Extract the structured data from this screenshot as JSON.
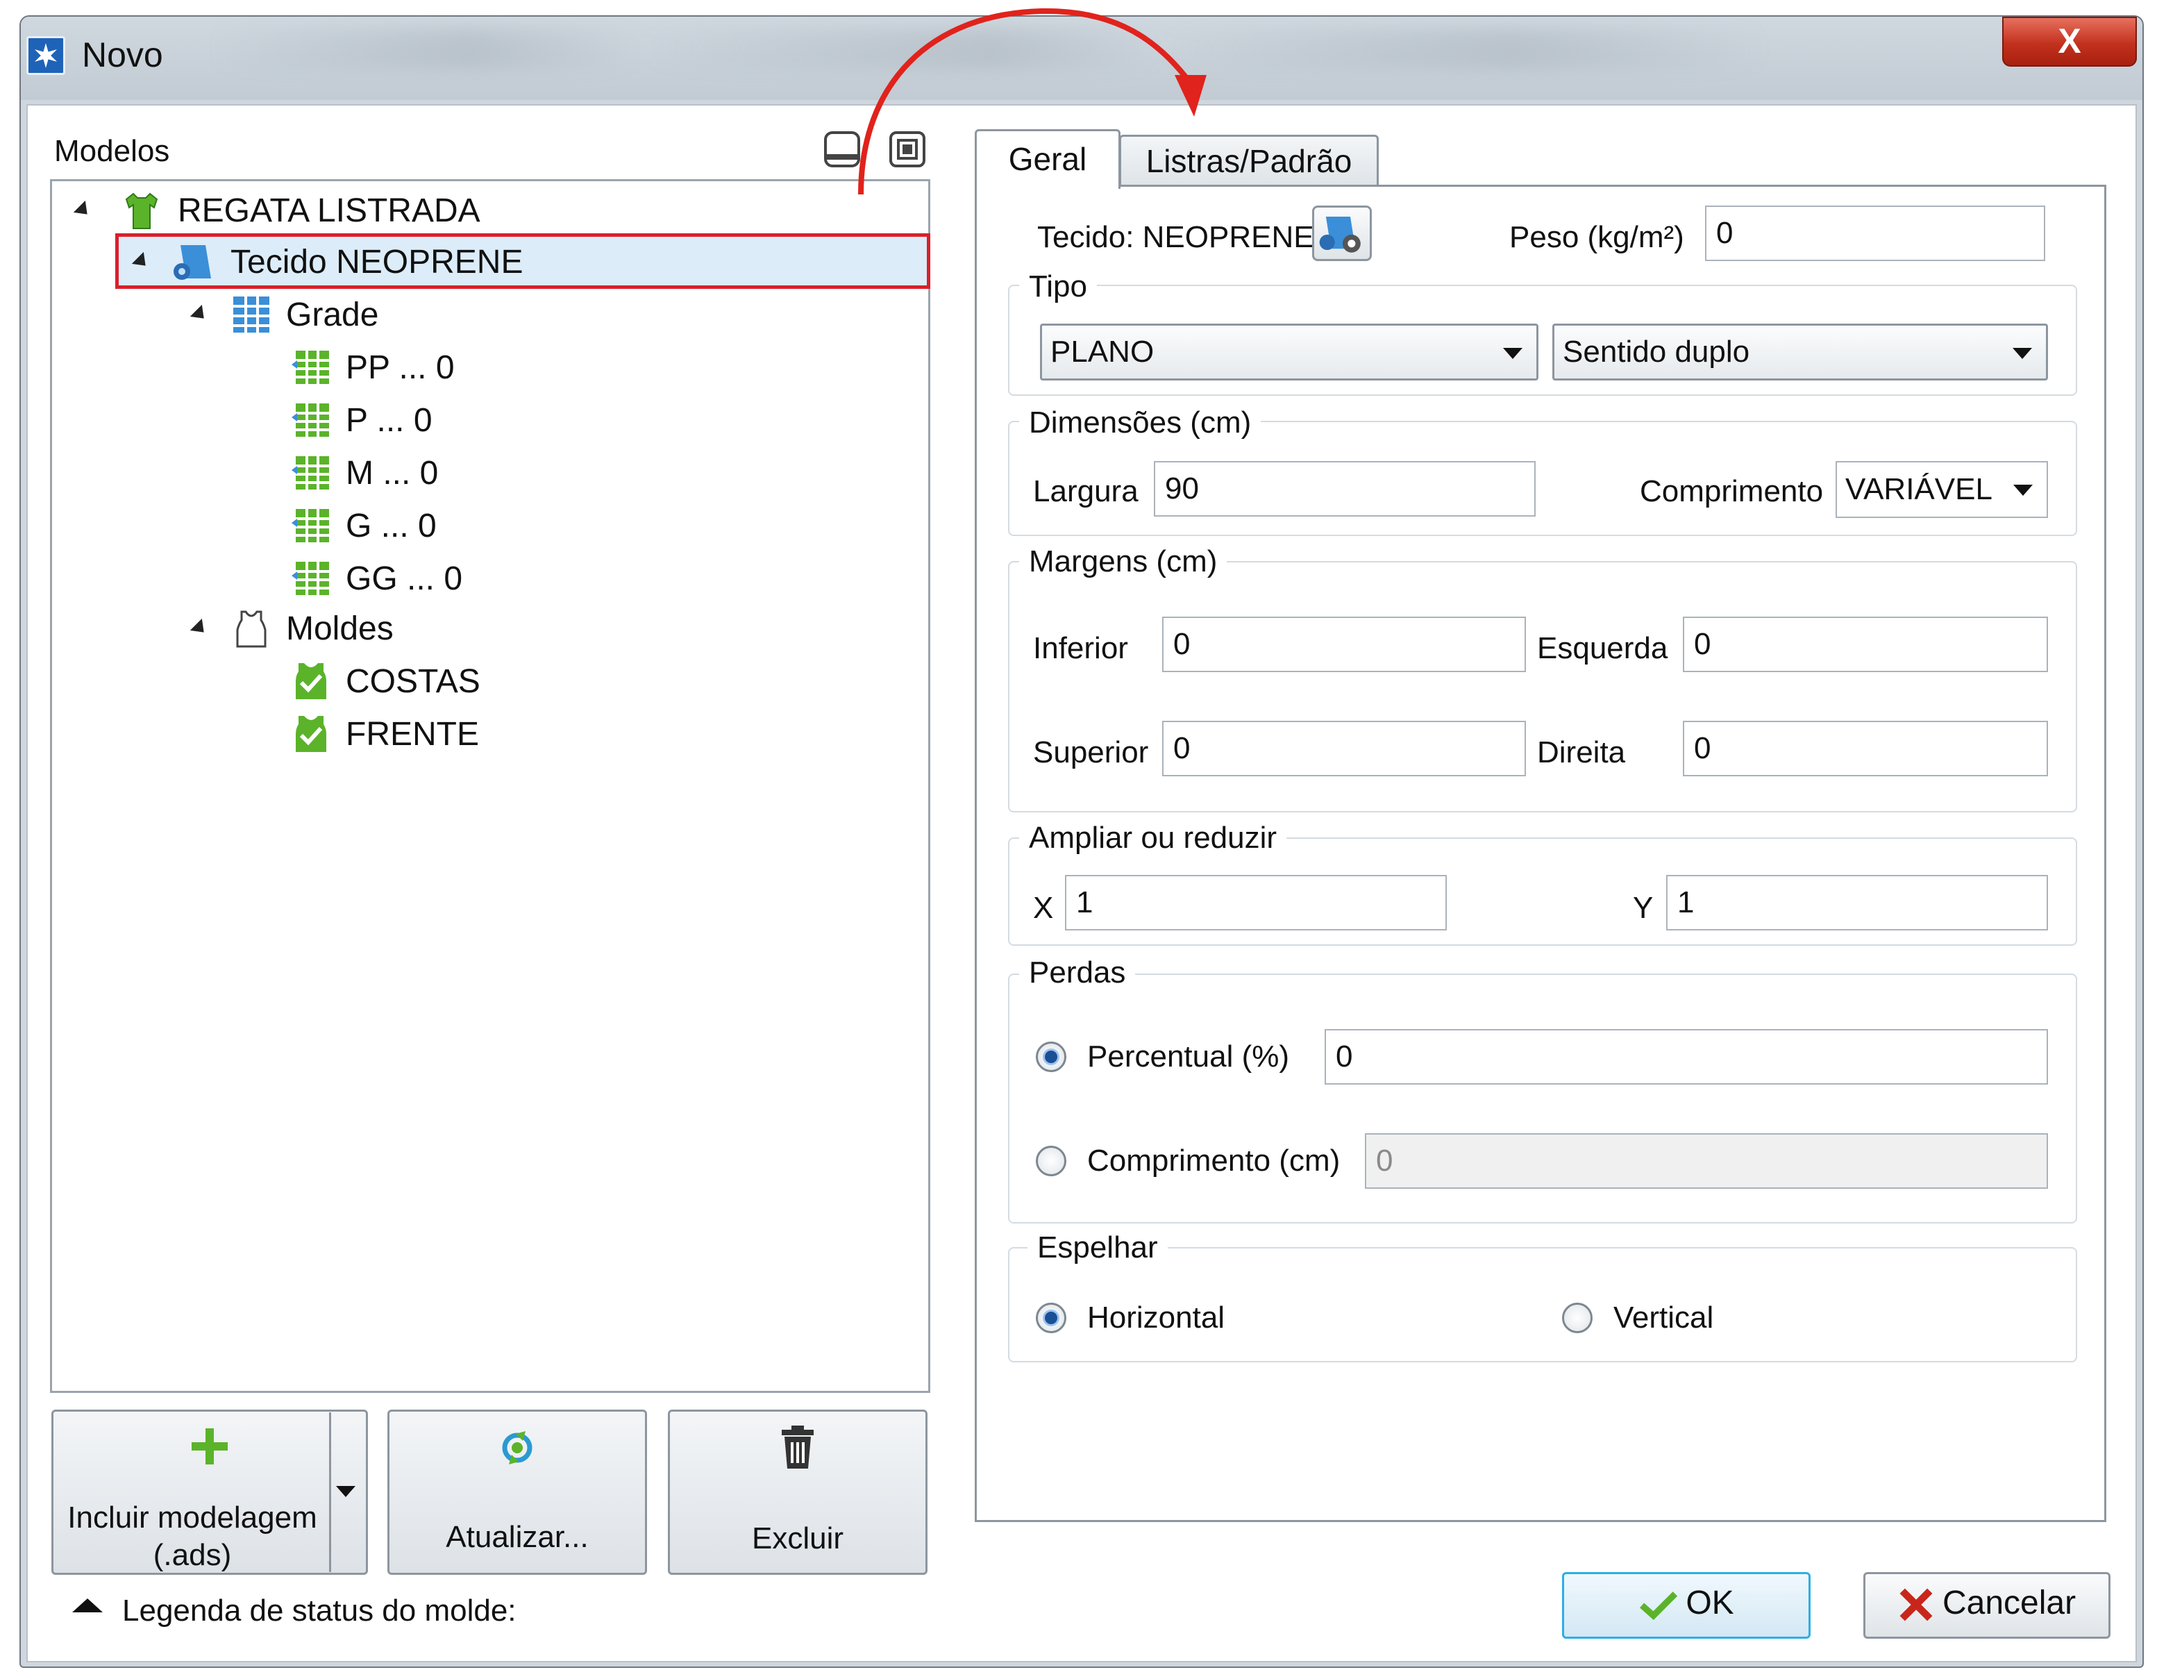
{
  "window": {
    "title": "Novo",
    "close_label": "X"
  },
  "left_panel": {
    "models_label": "Modelos",
    "tree": {
      "root": "REGATA LISTRADA",
      "fabric": "Tecido NEOPRENE",
      "grid": "Grade",
      "sizes": [
        "PP ... 0",
        "P ... 0",
        "M ... 0",
        "G ... 0",
        "GG ... 0"
      ],
      "molds": "Moldes",
      "parts": [
        "COSTAS",
        "FRENTE"
      ]
    },
    "buttons": {
      "include_line1": "Incluir modelagem",
      "include_line2": "(.ads)",
      "update": "Atualizar...",
      "delete": "Excluir"
    },
    "legend_text": "Legenda de status do molde:"
  },
  "tabs": {
    "general": "Geral",
    "stripes": "Listras/Padrão"
  },
  "general": {
    "fabric_label": "Tecido: NEOPRENE",
    "weight_label": "Peso (kg/m²)",
    "weight_value": "0",
    "type_group": "Tipo",
    "type_value": "PLANO",
    "direction_value": "Sentido duplo",
    "dimensions_group": "Dimensões (cm)",
    "width_label": "Largura",
    "width_value": "90",
    "length_label": "Comprimento",
    "length_value": "VARIÁVEL",
    "margins_group": "Margens (cm)",
    "bottom_label": "Inferior",
    "bottom_value": "0",
    "left_label": "Esquerda",
    "left_value": "0",
    "top_label": "Superior",
    "top_value": "0",
    "right_label": "Direita",
    "right_value": "0",
    "scale_group": "Ampliar ou reduzir",
    "x_label": "X",
    "x_value": "1",
    "y_label": "Y",
    "y_value": "1",
    "loss_group": "Perdas",
    "percent_label": "Percentual (%)",
    "percent_value": "0",
    "length_loss_label": "Comprimento (cm)",
    "length_loss_value": "0",
    "mirror_group": "Espelhar",
    "horizontal_label": "Horizontal",
    "vertical_label": "Vertical"
  },
  "footer": {
    "ok": "OK",
    "cancel": "Cancelar"
  },
  "colors": {
    "highlight": "#d9202a",
    "accent": "#1e63b8",
    "green": "#5bb32a"
  }
}
